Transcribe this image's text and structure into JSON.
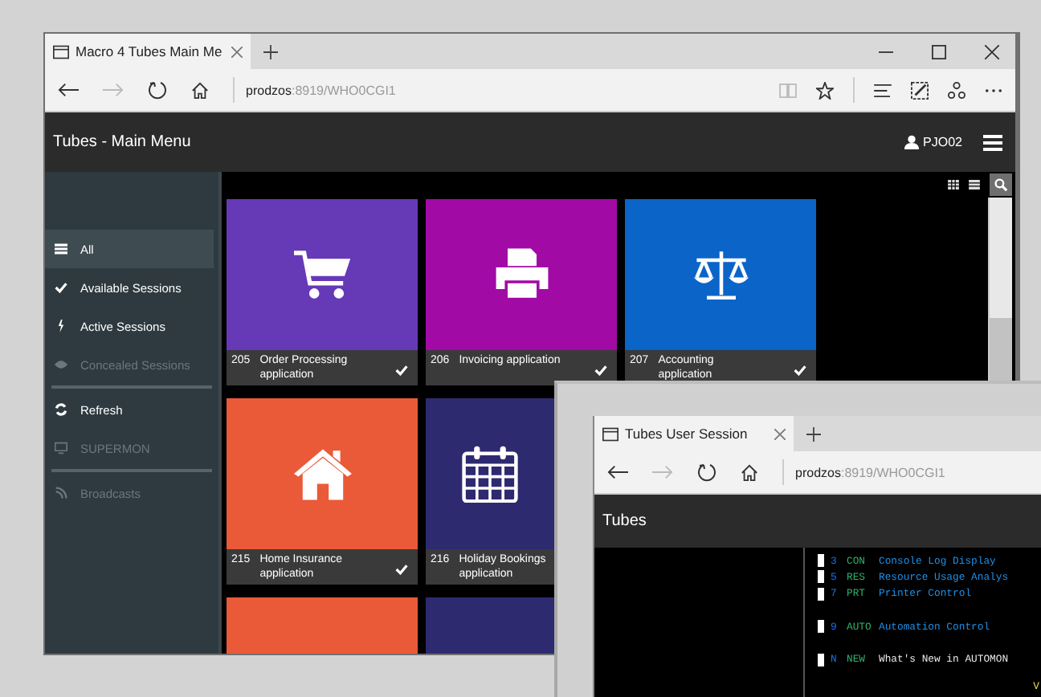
{
  "main_window": {
    "tab_title": "Macro 4 Tubes Main Me",
    "url_host": "prodzos",
    "url_path": ":8919/WHO0CGI1",
    "app_title": "Tubes - Main Menu",
    "user": "PJO02",
    "sidebar": [
      {
        "kind": "item",
        "label": "All",
        "selected": true,
        "disabled": false
      },
      {
        "kind": "item",
        "label": "Available Sessions",
        "selected": false,
        "disabled": false
      },
      {
        "kind": "item",
        "label": "Active Sessions",
        "selected": false,
        "disabled": false
      },
      {
        "kind": "item",
        "label": "Concealed Sessions",
        "selected": false,
        "disabled": true
      },
      {
        "kind": "divider"
      },
      {
        "kind": "item",
        "label": "Refresh",
        "selected": false,
        "disabled": false
      },
      {
        "kind": "item",
        "label": "SUPERMON",
        "selected": false,
        "disabled": true
      },
      {
        "kind": "divider"
      },
      {
        "kind": "item",
        "label": "Broadcasts",
        "selected": false,
        "disabled": true
      }
    ],
    "tile_rows": [
      [
        {
          "number": "205",
          "label": "Order Processing application",
          "checked": true,
          "color": "#6639b7"
        },
        {
          "number": "206",
          "label": "Invoicing application",
          "checked": true,
          "color": "#a20aa6"
        },
        {
          "number": "207",
          "label": "Accounting application",
          "checked": true,
          "color": "#0b64c8"
        }
      ],
      [
        {
          "number": "215",
          "label": "Home Insurance application",
          "checked": true,
          "color": "#ea5a38"
        },
        {
          "number": "216",
          "label": "Holiday Bookings application",
          "color": "#2e2a70"
        }
      ],
      [
        {
          "color": "#ea5a38"
        },
        {
          "color": "#2e2a70"
        }
      ]
    ]
  },
  "session_window": {
    "tab_title": "Tubes User Session",
    "url_host": "prodzos",
    "url_path": ":8919/WHO0CGI1",
    "app_title": "Tubes",
    "terminal": [
      {
        "kind": "option",
        "key": "3",
        "code": "CON",
        "text": "Console Log Display",
        "color": "#1e8fe6"
      },
      {
        "kind": "option",
        "key": "5",
        "code": "RES",
        "text": "Resource Usage Analys",
        "color": "#1e8fe6"
      },
      {
        "kind": "option",
        "key": "7",
        "code": "PRT",
        "text": "Printer Control",
        "color": "#1e8fe6"
      },
      {
        "kind": "blank"
      },
      {
        "kind": "option",
        "key": "9",
        "code": "AUTO",
        "text": "Automation Control",
        "color": "#1e8fe6"
      },
      {
        "kind": "blank"
      },
      {
        "kind": "option",
        "key": "N",
        "code": "NEW",
        "text": "What's New in AUTOMON",
        "color": "#e8e8e8"
      },
      {
        "kind": "trailer",
        "text": "V"
      }
    ]
  }
}
